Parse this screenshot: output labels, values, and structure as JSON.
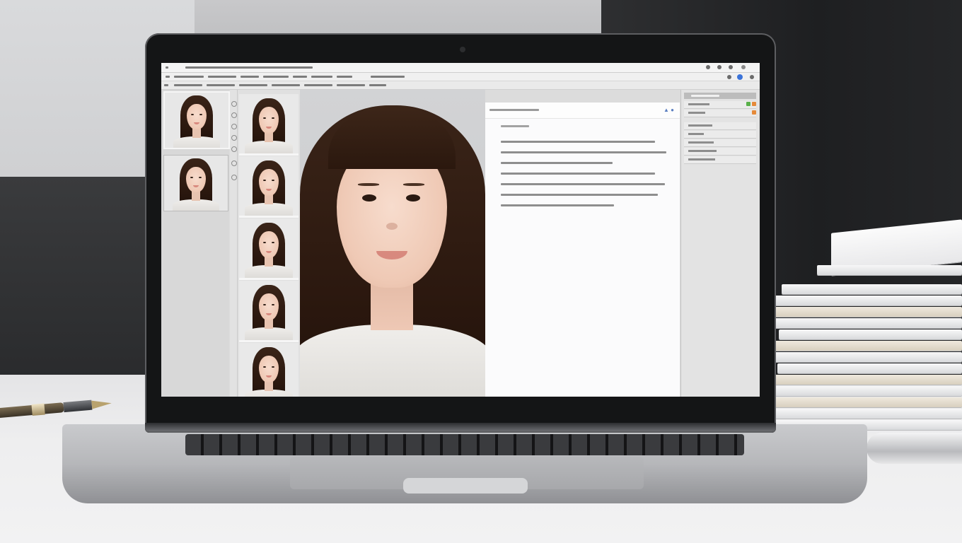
{
  "scene": {
    "description_tags": [
      "laptop",
      "desk",
      "pen",
      "paper-stack"
    ]
  },
  "app": {
    "window_title": "",
    "menu_items": [],
    "toolbar_items": []
  },
  "doc_panel": {
    "header_title": "",
    "section_label": "",
    "lines": []
  },
  "right_panel": {
    "header": "",
    "rows": []
  },
  "colors": {
    "accent": "#3b73d9",
    "badge_orange": "#e58a3a",
    "badge_green": "#59b04a"
  },
  "icons": [
    "window-minimize-icon",
    "window-maximize-icon",
    "window-close-icon",
    "sync-icon",
    "share-icon",
    "settings-icon"
  ]
}
